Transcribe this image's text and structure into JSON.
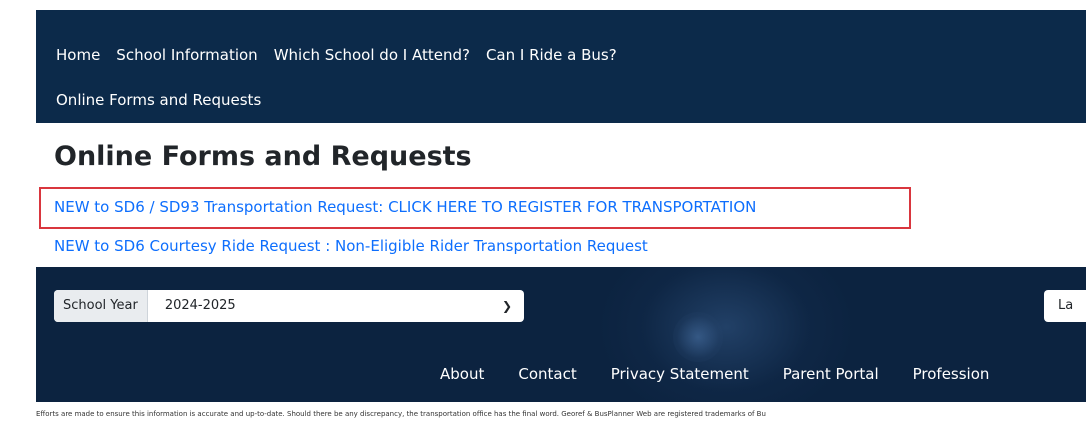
{
  "nav": {
    "items": [
      "Home",
      "School Information",
      "Which School do I Attend?",
      "Can I Ride a Bus?"
    ],
    "second_row": "Online Forms and Requests"
  },
  "page": {
    "title": "Online Forms and Requests",
    "links": [
      "NEW to SD6 / SD93 Transportation Request: CLICK HERE TO REGISTER FOR TRANSPORTATION",
      "NEW to SD6 Courtesy Ride Request : Non-Eligible Rider Transportation Request"
    ]
  },
  "footer": {
    "year_label": "School Year",
    "year_value": "2024-2025",
    "lang_partial": "La",
    "links": [
      "About",
      "Contact",
      "Privacy Statement",
      "Parent Portal",
      "Profession"
    ],
    "disclaimer": "Efforts are made to ensure this information is accurate and up-to-date. Should there be any discrepancy, the transportation office has the final word. Georef & BusPlanner Web are registered trademarks of Bu"
  },
  "colors": {
    "nav_bg": "#0c2a4a",
    "footer_bg": "#0c2340",
    "link": "#0d6efd",
    "highlight_border": "#d9363e"
  }
}
